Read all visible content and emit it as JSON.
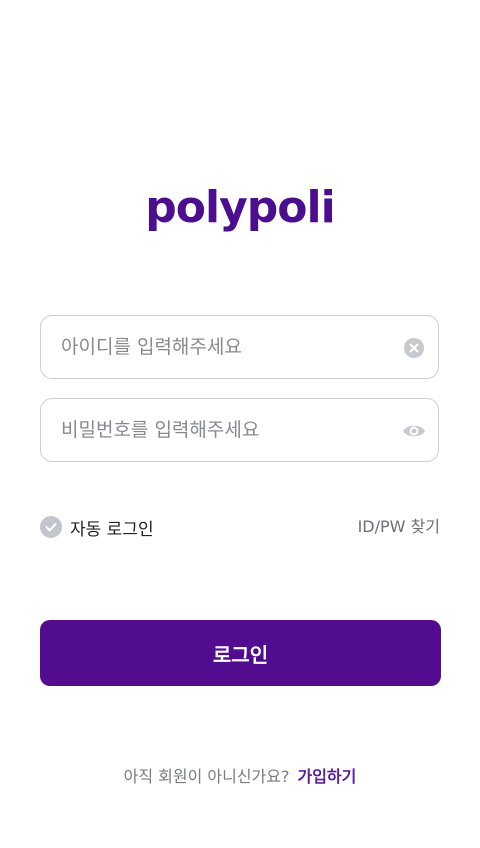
{
  "brand": {
    "logo_text": "polypoli"
  },
  "form": {
    "id_placeholder": "아이디를 입력해주세요",
    "pw_placeholder": "비밀번호를 입력해주세요",
    "auto_login_label": "자동 로그인",
    "find_label": "ID/PW 찾기",
    "login_label": "로그인"
  },
  "footer": {
    "signup_prompt": "아직 회원이 아니신가요?",
    "signup_link": "가입하기"
  },
  "icons": {
    "clear": "clear-icon",
    "show_password": "eye-icon",
    "auto_login_check": "check-circle-icon"
  },
  "colors": {
    "brand": "#520c90",
    "icon_gray": "#c8c8cf"
  }
}
